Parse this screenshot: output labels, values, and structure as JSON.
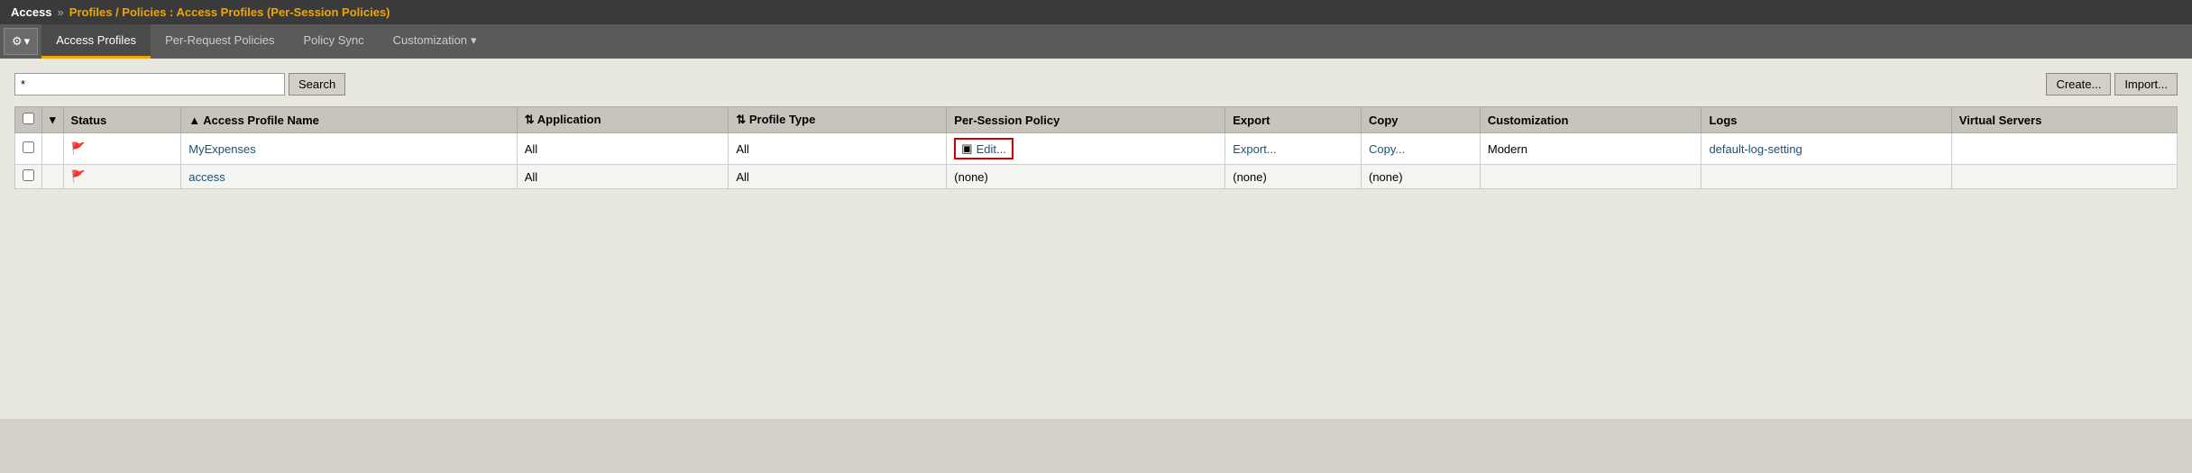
{
  "topbar": {
    "app_name": "Access",
    "chevrons": "»",
    "breadcrumb": "Profiles / Policies : Access Profiles (Per-Session Policies)"
  },
  "tabs": [
    {
      "id": "access-profiles",
      "label": "Access Profiles",
      "active": true
    },
    {
      "id": "per-request-policies",
      "label": "Per-Request Policies",
      "active": false
    },
    {
      "id": "policy-sync",
      "label": "Policy Sync",
      "active": false
    },
    {
      "id": "customization",
      "label": "Customization",
      "active": false,
      "dropdown": true
    }
  ],
  "search": {
    "value": "*",
    "placeholder": "",
    "button_label": "Search",
    "create_label": "Create...",
    "import_label": "Import..."
  },
  "table": {
    "columns": [
      {
        "id": "checkbox",
        "label": ""
      },
      {
        "id": "dropdown",
        "label": ""
      },
      {
        "id": "status",
        "label": "Status"
      },
      {
        "id": "profile-name",
        "label": "Access Profile Name",
        "sortable": true,
        "sort_dir": "asc"
      },
      {
        "id": "application",
        "label": "Application",
        "sortable": true
      },
      {
        "id": "profile-type",
        "label": "Profile Type",
        "sortable": true
      },
      {
        "id": "per-session-policy",
        "label": "Per-Session Policy"
      },
      {
        "id": "export",
        "label": "Export"
      },
      {
        "id": "copy",
        "label": "Copy"
      },
      {
        "id": "customization",
        "label": "Customization"
      },
      {
        "id": "logs",
        "label": "Logs"
      },
      {
        "id": "virtual-servers",
        "label": "Virtual Servers"
      }
    ],
    "rows": [
      {
        "id": 1,
        "status": "active",
        "profile_name": "MyExpenses",
        "application": "All",
        "profile_type": "All",
        "per_session_policy": "Edit...",
        "per_session_has_edit": true,
        "export": "Export...",
        "copy": "Copy...",
        "customization": "Modern",
        "logs": "default-log-setting",
        "virtual_servers": ""
      },
      {
        "id": 2,
        "status": "active",
        "profile_name": "access",
        "application": "All",
        "profile_type": "All",
        "per_session_policy": "(none)",
        "per_session_has_edit": false,
        "export": "(none)",
        "copy": "(none)",
        "customization": "",
        "logs": "",
        "virtual_servers": ""
      }
    ]
  },
  "icons": {
    "gear": "⚙",
    "chevron_down": "▾",
    "sort_asc": "▲",
    "sort_neutral": "⇅",
    "edit_icon": "▣"
  }
}
